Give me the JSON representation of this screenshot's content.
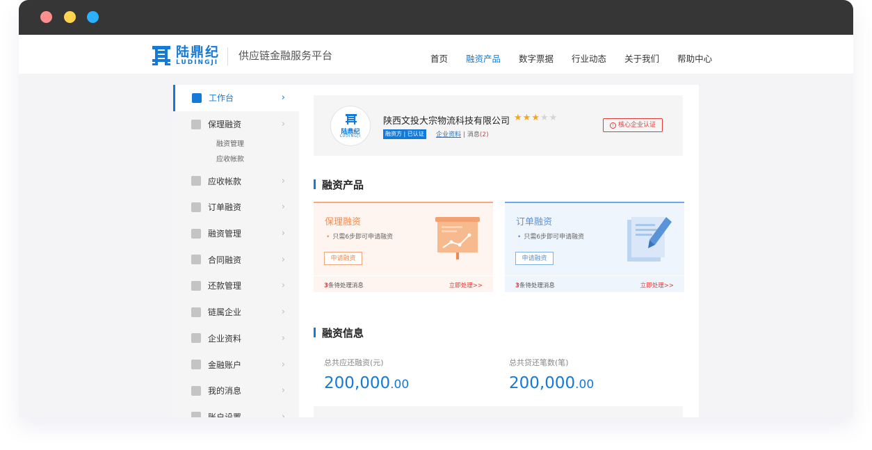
{
  "brand": {
    "logo_cn": "陆鼎纪",
    "logo_en": "LUDINGJI",
    "platform": "供应链金融服务平台"
  },
  "nav": {
    "items": [
      {
        "label": "首页"
      },
      {
        "label": "融资产品"
      },
      {
        "label": "数字票据"
      },
      {
        "label": "行业动态"
      },
      {
        "label": "关于我们"
      },
      {
        "label": "帮助中心"
      }
    ],
    "active": "融资产品"
  },
  "sidebar": {
    "items": [
      {
        "label": "工作台",
        "icon": "dashboard-icon"
      },
      {
        "label": "保理融资",
        "icon": "money-bag-icon",
        "sub": [
          "融资管理",
          "应收帐款"
        ]
      },
      {
        "label": "应收帐款",
        "icon": "shield-yen-icon"
      },
      {
        "label": "订单融资",
        "icon": "document-icon"
      },
      {
        "label": "融资管理",
        "icon": "grid-icon"
      },
      {
        "label": "合同融资",
        "icon": "contract-icon"
      },
      {
        "label": "还款管理",
        "icon": "pencil-icon"
      },
      {
        "label": "链属企业",
        "icon": "briefcase-icon"
      },
      {
        "label": "企业资料",
        "icon": "profile-card-icon"
      },
      {
        "label": "金融账户",
        "icon": "user-icon"
      },
      {
        "label": "我的消息",
        "icon": "bell-icon"
      },
      {
        "label": "账户设置",
        "icon": "gear-icon"
      }
    ],
    "arrow": "›"
  },
  "company": {
    "name": "陕西文投大宗物流科技有限公司",
    "rating": 3,
    "rating_max": 5,
    "tag": "融资方 | 已认证",
    "link_profile": "企业资料",
    "sep": "|",
    "messages_label": "消息",
    "messages_count": "(2)",
    "cert_label": "核心企业认证",
    "cert_icon": "!",
    "avatar_cn": "陆鼎纪",
    "avatar_en": "LUDINGJI"
  },
  "products": {
    "title": "融资产品",
    "cards": [
      {
        "title": "保理融资",
        "desc": "只需6步即可申请融资",
        "button": "申请融资",
        "pending_count": "3",
        "pending_text": "条待处理消息",
        "action": "立即处理>>",
        "illustration": "presentation-chart-icon"
      },
      {
        "title": "订单融资",
        "desc": "只需6步即可申请融资",
        "button": "申请融资",
        "pending_count": "3",
        "pending_text": "条待处理消息",
        "action": "立即处理>>",
        "illustration": "document-pen-icon"
      }
    ]
  },
  "financing": {
    "title": "融资信息",
    "stats": [
      {
        "label": "总共应还融资(元)",
        "integer": "200,000",
        "decimal": ".00"
      },
      {
        "label": "总共贷还笔数(笔)",
        "integer": "200,000",
        "decimal": ".00"
      }
    ]
  },
  "colors": {
    "accent": "#1479d7",
    "orange": "#ee8d56",
    "danger": "#e53935",
    "star": "#f4a623"
  }
}
